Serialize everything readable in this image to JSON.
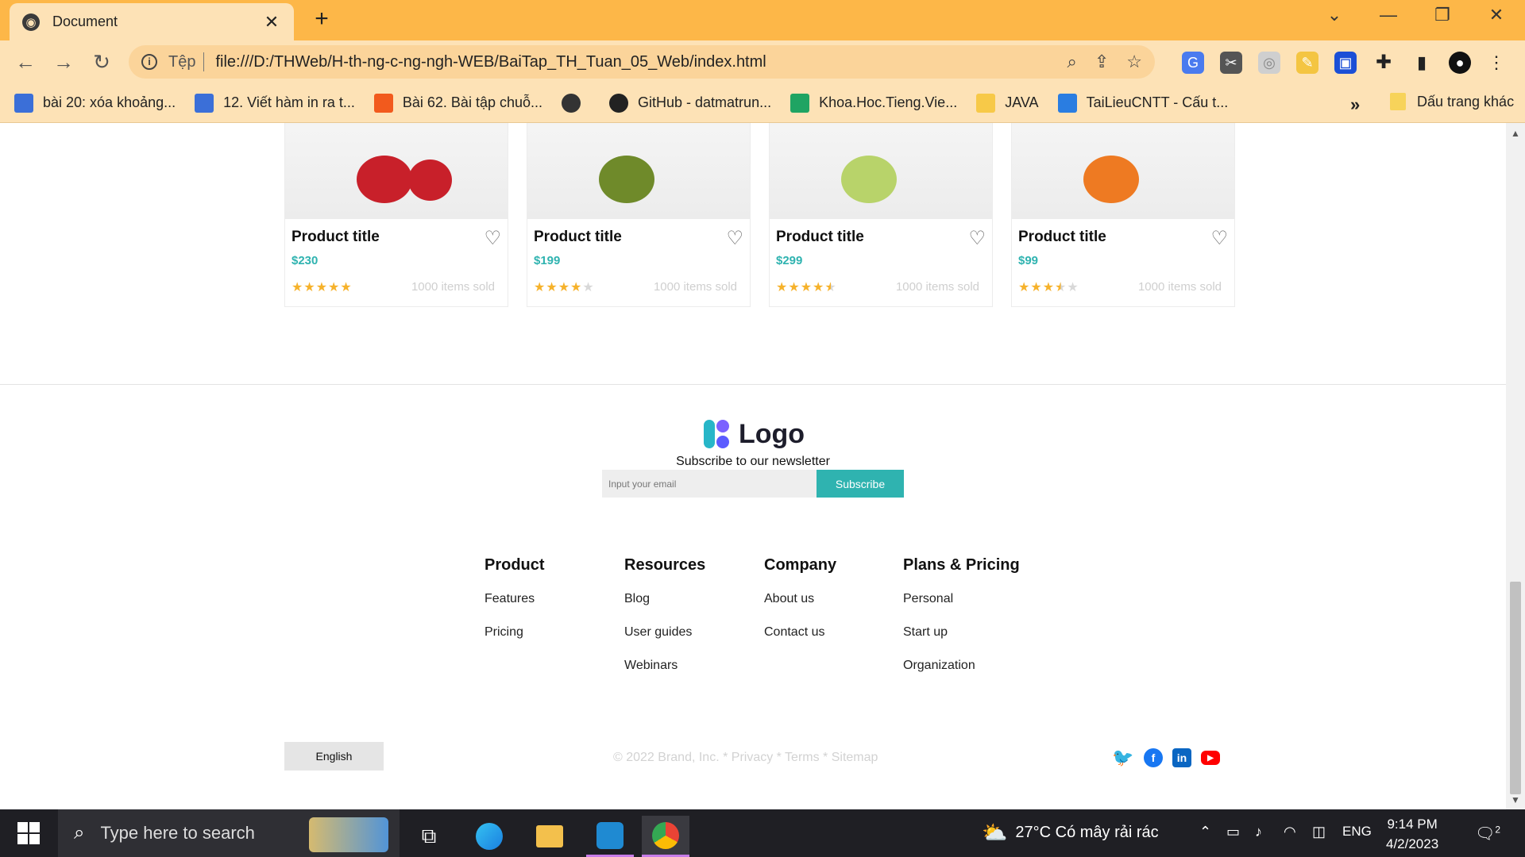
{
  "browser": {
    "tab_title": "Document",
    "scheme_label": "Tệp",
    "url": "file:///D:/THWeb/H-th-ng-c-ng-ngh-WEB/BaiTap_TH_Tuan_05_Web/index.html",
    "bookmarks": [
      {
        "label": "bài 20: xóa khoảng...",
        "icon": "calendar-icon",
        "color": "#3b6fd8"
      },
      {
        "label": "12. Viết hàm in ra t...",
        "icon": "calendar-icon",
        "color": "#3b6fd8"
      },
      {
        "label": "Bài 62. Bài tập chuỗ...",
        "icon": "fire-icon",
        "color": "#f25a1d"
      },
      {
        "label": "",
        "icon": "globe-icon",
        "color": "#333333"
      },
      {
        "label": "GitHub - datmatrun...",
        "icon": "github-icon",
        "color": "#222222"
      },
      {
        "label": "Khoa.Hoc.Tieng.Vie...",
        "icon": "drive-icon",
        "color": "#1fa463"
      },
      {
        "label": "JAVA",
        "icon": "folder-icon",
        "color": "#f7c948"
      },
      {
        "label": "TaiLieuCNTT - Cấu t...",
        "icon": "tailieu-icon",
        "color": "#2a7de1"
      }
    ],
    "more_label": "»",
    "other_bookmarks": "Dấu trang khác"
  },
  "products": [
    {
      "title": "Product title",
      "price": "$230",
      "rating": 5,
      "sold": "1000 items sold",
      "image": "cherries"
    },
    {
      "title": "Product title",
      "price": "$199",
      "rating": 4,
      "sold": "1000 items sold",
      "image": "avocado"
    },
    {
      "title": "Product title",
      "price": "$299",
      "rating": 4.5,
      "sold": "1000 items sold",
      "image": "lime"
    },
    {
      "title": "Product title",
      "price": "$99",
      "rating": 3.5,
      "sold": "1000 items sold",
      "image": "orange"
    }
  ],
  "footer": {
    "logo_text": "Logo",
    "newsletter_title": "Subscribe to our newsletter",
    "email_placeholder": "Input your email",
    "subscribe_label": "Subscribe",
    "columns": [
      {
        "title": "Product",
        "links": [
          "Features",
          "Pricing"
        ]
      },
      {
        "title": "Resources",
        "links": [
          "Blog",
          "User guides",
          "Webinars"
        ]
      },
      {
        "title": "Company",
        "links": [
          "About us",
          "Contact us"
        ]
      },
      {
        "title": "Plans & Pricing",
        "links": [
          "Personal",
          "Start up",
          "Organization"
        ]
      }
    ],
    "language": "English",
    "copyright": "© 2022 Brand, Inc. * Privacy * Terms * Sitemap",
    "social": [
      "twitter-icon",
      "facebook-icon",
      "linkedin-icon",
      "youtube-icon"
    ]
  },
  "taskbar": {
    "search_placeholder": "Type here to search",
    "weather": "27°C  Có mây rải rác",
    "lang": "ENG",
    "time": "9:14 PM",
    "date": "4/2/2023",
    "notif_count": "2"
  },
  "colors": {
    "accent": "#2fb3b0",
    "browser_frame": "#fdb748",
    "star": "#f6b22b"
  }
}
